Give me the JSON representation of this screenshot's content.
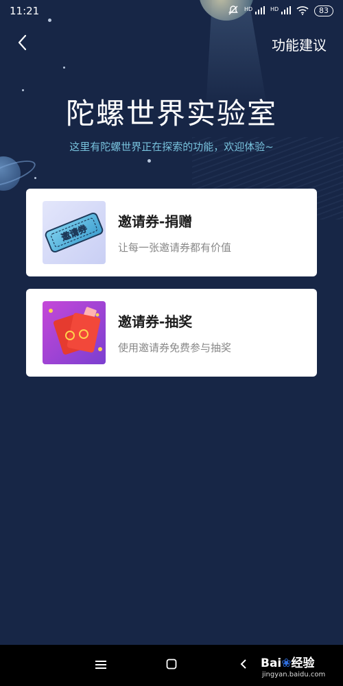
{
  "status_bar": {
    "time": "11:21",
    "signal1": "HD",
    "signal2": "HD",
    "battery": "83"
  },
  "nav": {
    "back_icon": "chevron-left-icon",
    "suggest_label": "功能建议"
  },
  "header": {
    "title": "陀螺世界实验室",
    "subtitle": "这里有陀螺世界正在探索的功能，欢迎体验~"
  },
  "features": [
    {
      "title": "邀请券-捐赠",
      "desc": "让每一张邀请券都有价值",
      "image_text": "邀请券",
      "icon": "ticket-icon"
    },
    {
      "title": "邀请券-抽奖",
      "desc": "使用邀请券免费参与抽奖",
      "icon": "red-envelope-icon"
    }
  ],
  "system_nav": {
    "menu_icon": "menu-icon",
    "home_icon": "home-square-icon",
    "back_icon": "back-triangle-icon"
  },
  "watermark": {
    "brand": "Bai",
    "brand2": "经验",
    "url": "jingyan.baidu.com"
  },
  "colors": {
    "background": "#172646",
    "subtitle": "#78c2dd",
    "card": "#ffffff"
  }
}
